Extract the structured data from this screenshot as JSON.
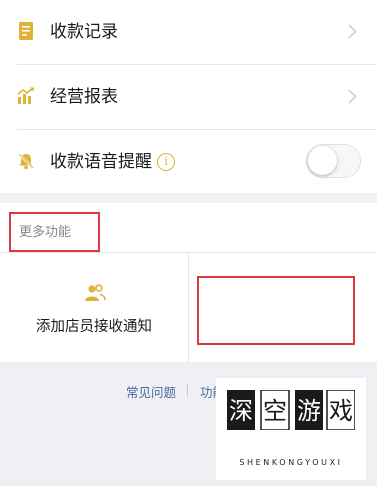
{
  "menu": {
    "records_label": "收款记录",
    "report_label": "经营报表",
    "voice_label": "收款语音提醒",
    "voice_enabled": false
  },
  "more": {
    "section_title": "更多功能",
    "staff_notify_label": "添加店员接收通知"
  },
  "footer": {
    "faq_label": "常见问题",
    "feature_label": "功能"
  },
  "watermark": {
    "title": "深空游戏",
    "subtitle": "SHENKONGYOUXI"
  },
  "colors": {
    "accent": "#e0b23a",
    "highlight": "#d9393c",
    "link": "#4a6ca0"
  }
}
